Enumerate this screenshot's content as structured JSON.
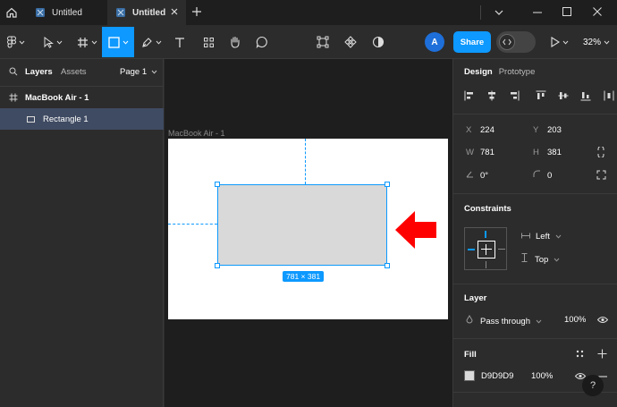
{
  "tabs": [
    {
      "label": "Untitled",
      "active": false
    },
    {
      "label": "Untitled",
      "active": true
    }
  ],
  "toolbar": {
    "avatar_initial": "A",
    "share_label": "Share",
    "zoom": "32%"
  },
  "layers_panel": {
    "tab_layers": "Layers",
    "tab_assets": "Assets",
    "page_selector": "Page 1",
    "frame_name": "MacBook Air - 1",
    "selected_layer": "Rectangle 1"
  },
  "canvas": {
    "frame_label": "MacBook Air - 1",
    "size_badge": "781 × 381"
  },
  "design_panel": {
    "tab_design": "Design",
    "tab_prototype": "Prototype",
    "x_label": "X",
    "x_value": "224",
    "y_label": "Y",
    "y_value": "203",
    "w_label": "W",
    "w_value": "781",
    "h_label": "H",
    "h_value": "381",
    "rotation_value": "0°",
    "corner_value": "0",
    "constraints_title": "Constraints",
    "constraint_h": "Left",
    "constraint_v": "Top",
    "layer_title": "Layer",
    "blend_mode": "Pass through",
    "layer_opacity": "100%",
    "fill_title": "Fill",
    "fill_hex": "D9D9D9",
    "fill_opacity": "100%",
    "help_label": "?"
  },
  "colors": {
    "accent": "#0d99ff",
    "fill": "#d9d9d9",
    "annotation_arrow": "#ff0000"
  }
}
